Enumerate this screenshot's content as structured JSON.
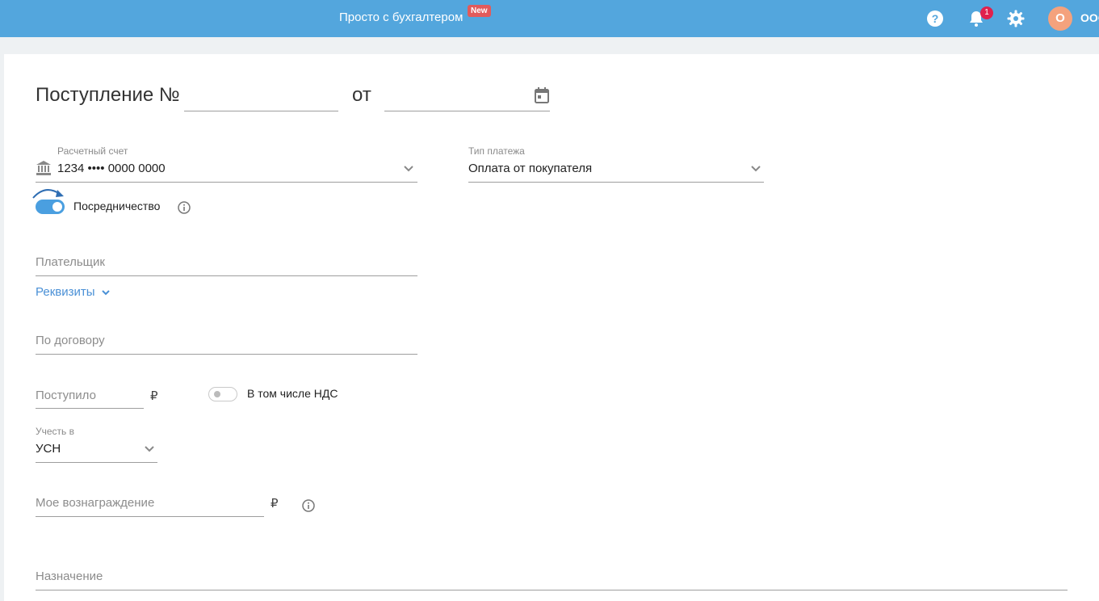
{
  "header": {
    "app_title": "Просто с бухгалтером",
    "new_badge": "New",
    "notifications_count": "1",
    "avatar_letter": "О",
    "company_label": "ООО"
  },
  "form": {
    "heading": "Поступление №",
    "date_sep": "от",
    "account": {
      "label": "Расчетный счет",
      "value": "1234 •••• 0000 0000"
    },
    "payment_type": {
      "label": "Тип платежа",
      "value": "Оплата от покупателя"
    },
    "mediation": {
      "label": "Посредничество",
      "enabled": true
    },
    "payer": {
      "placeholder": "Плательщик"
    },
    "requisites_link": "Реквизиты",
    "contract": {
      "placeholder": "По договору"
    },
    "received": {
      "placeholder": "Поступило",
      "currency": "₽"
    },
    "vat_toggle": {
      "label": "В том числе НДС",
      "enabled": false
    },
    "account_in": {
      "label": "Учесть в",
      "value": "УСН"
    },
    "reward": {
      "placeholder": "Мое вознаграждение",
      "currency": "₽"
    },
    "purpose": {
      "placeholder": "Назначение"
    }
  },
  "colors": {
    "header_bg": "#53a6dd",
    "accent": "#4a9fe0",
    "badge_red": "#e25b5b"
  }
}
